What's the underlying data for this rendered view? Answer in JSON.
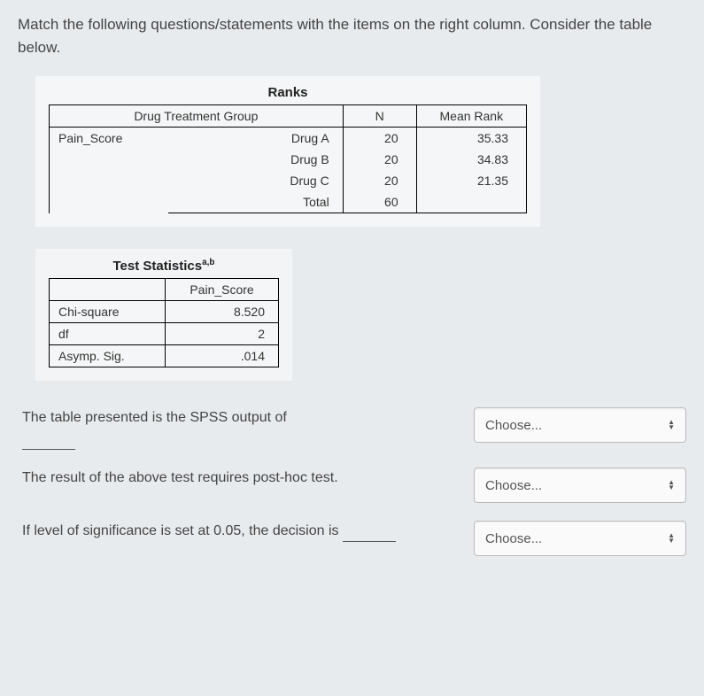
{
  "instruction": "Match the following questions/statements with the items on the right column. Consider the table below.",
  "ranks_table": {
    "title": "Ranks",
    "group_header": "Drug Treatment Group",
    "col_n": "N",
    "col_mean": "Mean Rank",
    "row_variable": "Pain_Score",
    "rows": [
      {
        "label": "Drug A",
        "n": "20",
        "mean": "35.33"
      },
      {
        "label": "Drug B",
        "n": "20",
        "mean": "34.83"
      },
      {
        "label": "Drug C",
        "n": "20",
        "mean": "21.35"
      },
      {
        "label": "Total",
        "n": "60",
        "mean": ""
      }
    ]
  },
  "stats_table": {
    "title": "Test Statistics",
    "superscript": "a,b",
    "col_header": "Pain_Score",
    "rows": [
      {
        "label": "Chi-square",
        "value": "8.520"
      },
      {
        "label": "df",
        "value": "2"
      },
      {
        "label": "Asymp. Sig.",
        "value": ".014"
      }
    ]
  },
  "questions": {
    "q1": "The table presented is the SPSS output of",
    "q2": "The result of the above test requires post-hoc test.",
    "q3_part1": "If level of significance is set at 0.05, the decision is",
    "dropdown_placeholder": "Choose..."
  }
}
